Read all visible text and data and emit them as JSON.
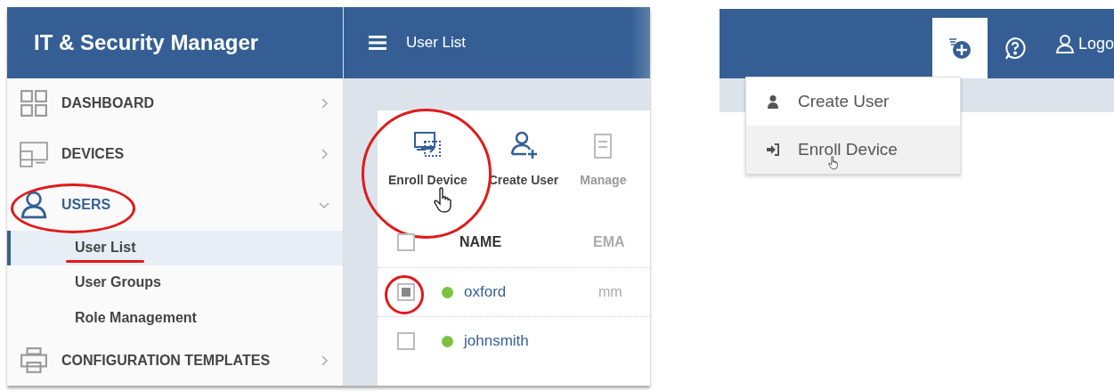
{
  "sidebar": {
    "title": "IT & Security Manager",
    "items": [
      {
        "label": "DASHBOARD",
        "expanded": false,
        "selected": false
      },
      {
        "label": "DEVICES",
        "expanded": false,
        "selected": false
      },
      {
        "label": "USERS",
        "expanded": true,
        "selected": true,
        "children": [
          {
            "label": "User List",
            "selected": true
          },
          {
            "label": "User Groups",
            "selected": false
          },
          {
            "label": "Role Management",
            "selected": false
          }
        ]
      },
      {
        "label": "CONFIGURATION TEMPLATES",
        "expanded": false,
        "selected": false
      }
    ]
  },
  "header": {
    "title": "User List"
  },
  "toolbar": [
    {
      "label": "Enroll Device"
    },
    {
      "label": "Create User"
    },
    {
      "label": "Manage"
    }
  ],
  "table": {
    "select_all_checked": false,
    "columns": [
      "NAME",
      "EMA"
    ],
    "rows": [
      {
        "checked": true,
        "name": "oxford",
        "column_2": "mm",
        "color": "#7cc242"
      },
      {
        "checked": false,
        "name": "johnsmith",
        "color": "#7cc242"
      }
    ]
  },
  "top_bar": {
    "buttons": [
      {
        "kind": "add",
        "selected": true
      },
      {
        "kind": "help",
        "selected": false
      }
    ],
    "logout": "Logo"
  },
  "dropdown": [
    {
      "label": "Create User",
      "hovered": false
    },
    {
      "label": "Enroll Device",
      "hovered": true
    }
  ]
}
